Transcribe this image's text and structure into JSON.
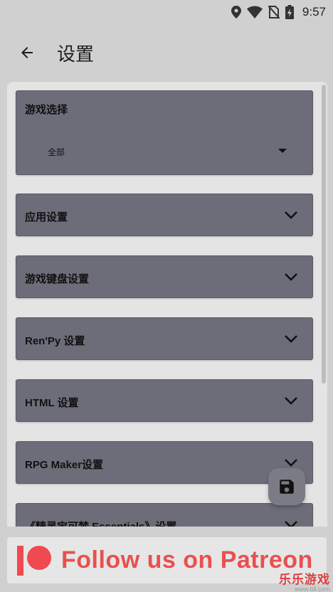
{
  "status_bar": {
    "time": "9:57",
    "icons": [
      "location-icon",
      "wifi-icon",
      "no-sim-icon",
      "battery-charging-icon"
    ]
  },
  "app_bar": {
    "back_icon": "arrow-left-icon",
    "title": "设置"
  },
  "game_select": {
    "label": "游戏选择",
    "selected": "全部"
  },
  "sections": [
    {
      "label": "应用设置"
    },
    {
      "label": "游戏键盘设置"
    },
    {
      "label": "Ren'Py 设置"
    },
    {
      "label": "HTML 设置"
    },
    {
      "label": "RPG Maker设置"
    },
    {
      "label": "《精灵宝可梦 Essentials》设置"
    }
  ],
  "fab": {
    "icon": "save-icon"
  },
  "ad": {
    "text": "Follow us on Patreon"
  },
  "watermark": {
    "main": "乐乐游戏",
    "sub": "www.6ll.com"
  },
  "colors": {
    "background": "#d0d0d0",
    "panel": "#e4e4e4",
    "card": "#6d6d7a",
    "fab": "#7b7b85",
    "patreon": "#f0494f"
  }
}
